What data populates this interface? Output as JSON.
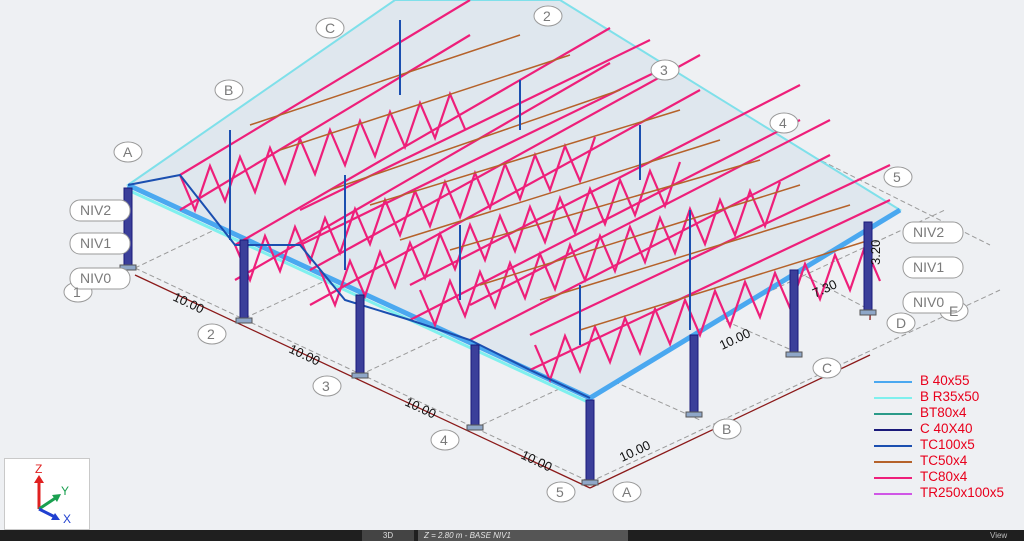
{
  "grid_letters": {
    "A": "A",
    "B": "B",
    "C": "C",
    "D": "D",
    "E": "E"
  },
  "grid_numbers": {
    "n1": "1",
    "n2": "2",
    "n3": "3",
    "n4": "4",
    "n5": "5"
  },
  "levels": {
    "niv0": "NIV0",
    "niv1": "NIV1",
    "niv2": "NIV2"
  },
  "dimensions": {
    "span": "10.00",
    "depth": "7.30",
    "height": "3.20"
  },
  "legend": [
    {
      "label": "B 40x55",
      "color": "#4aa8f0"
    },
    {
      "label": "B R35x50",
      "color": "#7ff0ee"
    },
    {
      "label": "BT80x4",
      "color": "#2a9a88"
    },
    {
      "label": "C 40X40",
      "color": "#1a1a7a"
    },
    {
      "label": "TC100x5",
      "color": "#1b4fb0"
    },
    {
      "label": "TC50x4",
      "color": "#b5622a"
    },
    {
      "label": "TC80x4",
      "color": "#ee1f7a"
    },
    {
      "label": "TR250x100x5",
      "color": "#d056e6"
    }
  ],
  "axes": {
    "z": "Z",
    "y": "Y",
    "x": "X"
  },
  "status": {
    "view": "3D",
    "z_info": "Z = 2.80 m - BASE NIV1",
    "right": "View"
  }
}
